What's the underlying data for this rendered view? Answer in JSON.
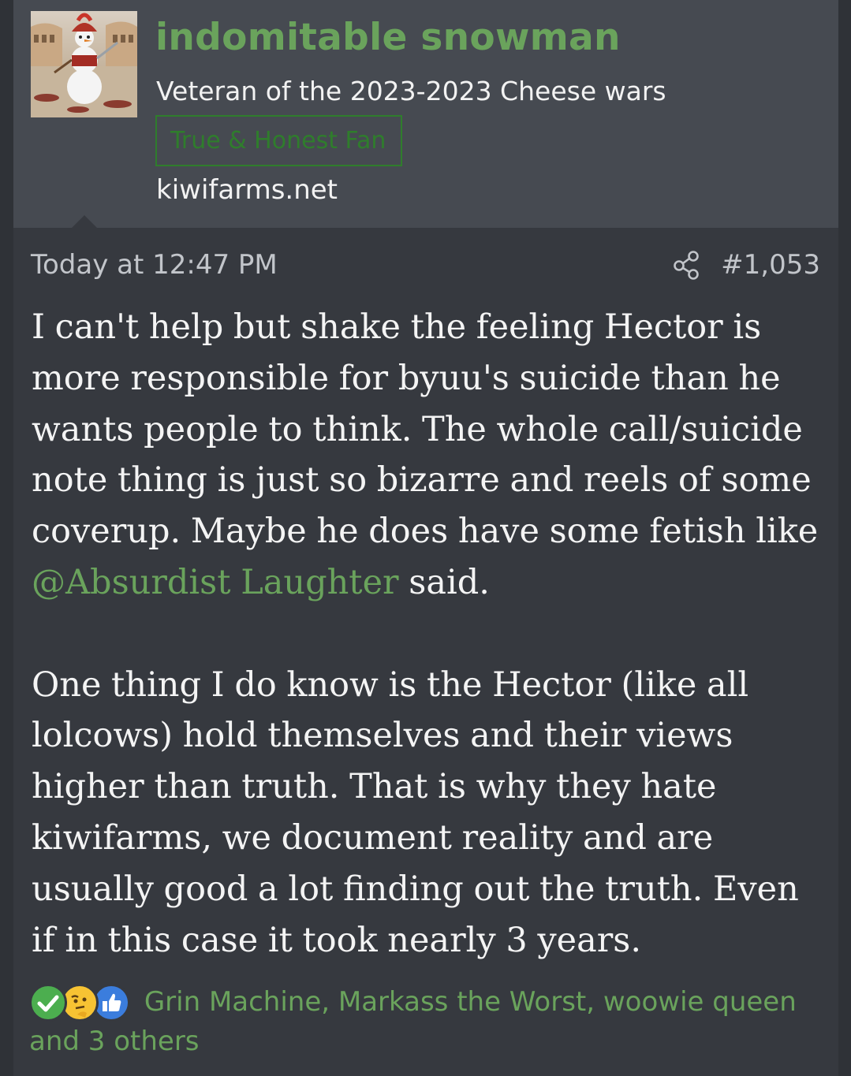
{
  "author": {
    "username": "indomitable snowman",
    "title": "Veteran of the 2023-2023 Cheese wars",
    "banner": "True & Honest Fan",
    "site": "kiwifarms.net",
    "avatar_icon": "snowman-gladiator-avatar"
  },
  "post": {
    "timestamp": "Today at 12:47 PM",
    "number": "#1,053",
    "share_icon": "share-icon",
    "paragraph1_before": "I can't help but shake the feeling Hector is more responsible for byuu's suicide than he wants people to think. The whole call/suicide note thing is just so bizarre and reels of some coverup. Maybe he does have some fetish like ",
    "mention": "@Absurdist Laughter",
    "paragraph1_after": " said.",
    "paragraph2": "One thing I do know is the Hector (like all lolcows) hold themselves and their views higher than truth. That is why they hate kiwifarms, we document reality and are usually good a lot finding out the truth. Even if in this case it took nearly 3 years."
  },
  "reactions": {
    "icons": [
      "check-icon",
      "thinking-icon",
      "thumbs-up-icon"
    ],
    "text": "Grin Machine, Markass the Worst, woowie queen and 3 others"
  },
  "colors": {
    "accent_green": "#6aa35c",
    "banner_green": "#2f7d2c",
    "header_bg": "#464a51",
    "body_bg": "#36393f"
  }
}
